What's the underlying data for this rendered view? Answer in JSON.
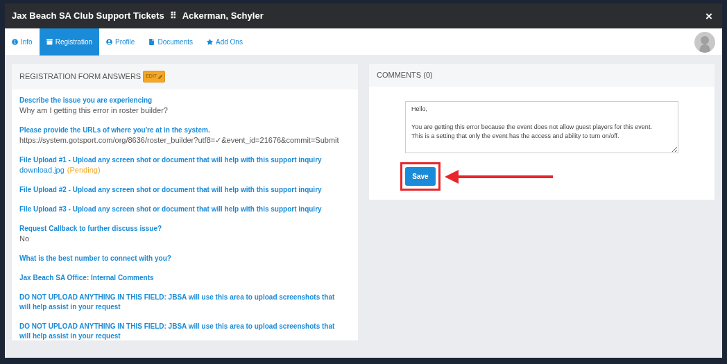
{
  "modal": {
    "title": "Jax Beach SA Club Support Tickets",
    "separator": "⠿",
    "subtitle": "Ackerman, Schyler",
    "close": "×"
  },
  "tabs": [
    {
      "label": "Info",
      "selected": false
    },
    {
      "label": "Registration",
      "selected": true
    },
    {
      "label": "Profile",
      "selected": false
    },
    {
      "label": "Documents",
      "selected": false
    },
    {
      "label": "Add Ons",
      "selected": false
    }
  ],
  "answers_panel": {
    "title": "REGISTRATION FORM ANSWERS",
    "edit_button": "EDIT",
    "items": [
      {
        "question": "Describe the issue you are experiencing",
        "answer": {
          "kind": "text",
          "text": "Why am I getting this error in roster builder?"
        }
      },
      {
        "question": "Please provide the URLs of where you're at in the system.",
        "answer": {
          "kind": "text",
          "text": "https://system.gotsport.com/org/8636/roster_builder?utf8=✓&event_id=21676&commit=Submit"
        }
      },
      {
        "question": "File Upload #1 - Upload any screen shot or document that will help with this support inquiry",
        "answer": {
          "kind": "file",
          "text": "download.jpg",
          "status": "(Pending)"
        }
      },
      {
        "question": "File Upload #2 - Upload any screen shot or document that will help with this support inquiry"
      },
      {
        "question": "File Upload #3 - Upload any screen shot or document that will help with this support inquiry"
      },
      {
        "question": "Request Callback to further discuss issue?",
        "answer": {
          "kind": "text",
          "text": "No"
        }
      },
      {
        "question": "What is the best number to connect with you?"
      },
      {
        "question": "Jax Beach SA Office: Internal Comments"
      },
      {
        "question": "DO NOT UPLOAD ANYTHING IN THIS FIELD: JBSA will use this area to upload screenshots that will help assist in your request"
      },
      {
        "question": "DO NOT UPLOAD ANYTHING IN THIS FIELD: JBSA will use this area to upload screenshots that will help assist in your request"
      }
    ]
  },
  "comments_panel": {
    "title": "COMMENTS (0)",
    "comment_field": "Hello,\n\nYou are getting this error because the event does not allow guest players for this event.\nThis is a setting that only the event has the access and ability to turn on/off.",
    "save_button": "Save",
    "highlighted": true
  }
}
